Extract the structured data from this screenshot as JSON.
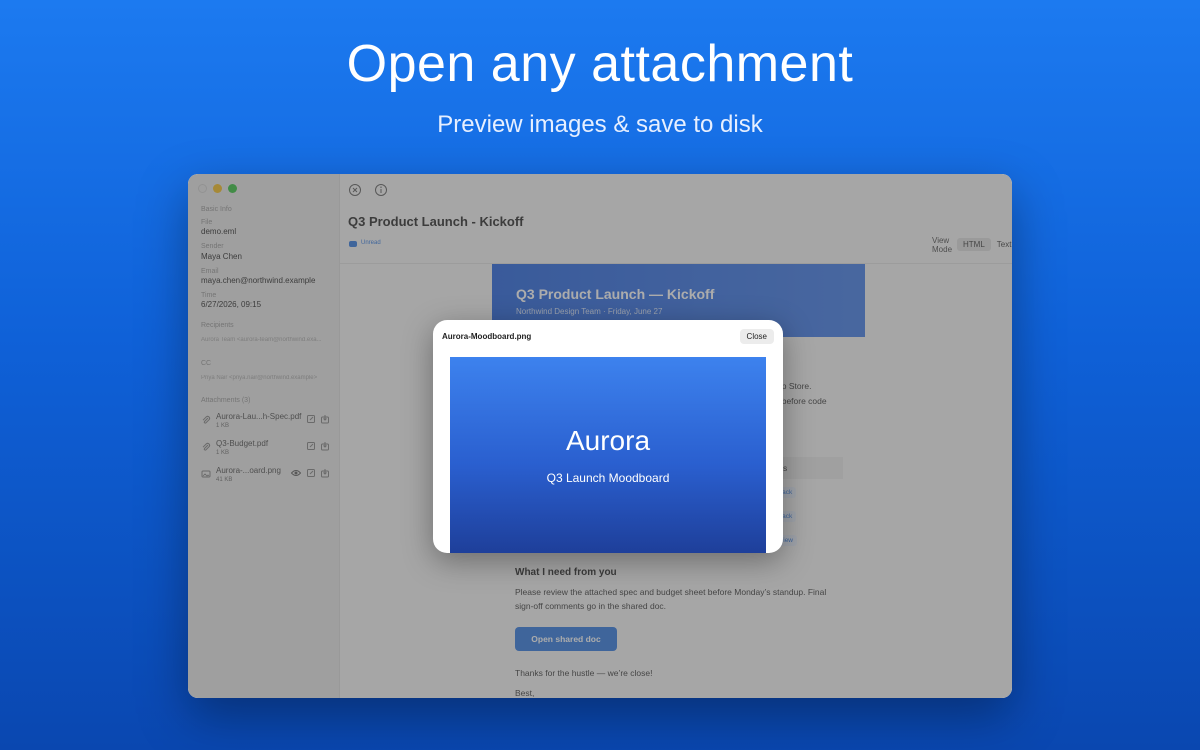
{
  "hero": {
    "title": "Open any attachment",
    "subtitle": "Preview images & save to disk"
  },
  "sidebar": {
    "section_basic": "Basic Info",
    "file_label": "File",
    "file_value": "demo.eml",
    "sender_label": "Sender",
    "sender_value": "Maya Chen",
    "email_label": "Email",
    "email_value": "maya.chen@northwind.example",
    "time_label": "Time",
    "time_value": "6/27/2026, 09:15",
    "recipients_label": "Recipients",
    "recipients_value": "Aurora Team <aurora-team@northwind.exa...",
    "cc_label": "CC",
    "cc_value": "Priya Nair <priya.nair@northwind.example>",
    "attachments_label": "Attachments (3)",
    "attachments": [
      {
        "name": "Aurora-Lau...h-Spec.pdf",
        "size": "1 KB",
        "icon": "paperclip-icon"
      },
      {
        "name": "Q3-Budget.pdf",
        "size": "1 KB",
        "icon": "paperclip-icon"
      },
      {
        "name": "Aurora-...oard.png",
        "size": "41 KB",
        "icon": "image-icon"
      }
    ]
  },
  "message": {
    "title": "Q3 Product Launch - Kickoff",
    "status": "Unread",
    "view_mode_label": "View\nMode",
    "view_modes": [
      "HTML",
      "Text"
    ],
    "active_view_mode": "HTML"
  },
  "email": {
    "banner_title": "Q3 Product Launch — Kickoff",
    "banner_subtitle": "Northwind Design Team · Friday, June 27",
    "frag_store": "op Store.",
    "frag_code": "t before code",
    "frag_header": "s",
    "pill_1": "rack",
    "pill_2": "rack",
    "pill_3": "view",
    "section_title": "What I need from you",
    "paragraph": "Please review the attached spec and budget sheet before Monday’s standup. Final sign-off comments go in the shared doc.",
    "cta": "Open shared doc",
    "thanks": "Thanks for the hustle — we’re close!",
    "signoff": "Best,"
  },
  "modal": {
    "title": "Aurora-Moodboard.png",
    "close_label": "Close",
    "preview_title": "Aurora",
    "preview_subtitle": "Q3 Launch Moodboard"
  },
  "colors": {
    "accent": "#3a7fe0",
    "background_top": "#1c7af0",
    "background_bottom": "#0a47b0"
  }
}
